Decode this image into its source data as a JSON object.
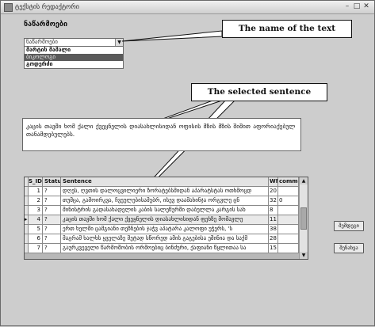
{
  "window": {
    "title": "ტექსტის რედაქტორი",
    "controls": [
      "–",
      "□",
      "✕"
    ]
  },
  "text_section": {
    "heading": "ნაწარმოები",
    "combo_value": "ნაწარმოები",
    "options": [
      "მარტის მამალი",
      "ბიკოლოგი",
      "გოდერძი"
    ],
    "selected_index": 1
  },
  "callouts": {
    "text_name": "The name of the text",
    "selected_sentence": "The selected sentence"
  },
  "sentence_box": {
    "text": "კაცის თავში ხომ ქალი ქვეყნელის დიასახლისიდან  ოფისის მზის მზის შიშით აფორიაქებულ თანამდებულებს."
  },
  "grid": {
    "headers": {
      "indicator": "",
      "id": "S_ID",
      "status": "Status",
      "sentence": "Sentence",
      "wn": "WNo",
      "comments": "comments"
    },
    "rows": [
      {
        "id": "1",
        "status": "?",
        "sentence": "დღეს, ღვთის დალოცვილიერი ზორატებსმიდან აპარატსტას ოთხმოცდ",
        "wn": "20",
        "comments": ""
      },
      {
        "id": "2",
        "status": "?",
        "sentence": "თუმცა, გამოირკვა, ჩვეულებისამებრ, ისევ დაამახინჯა ორგვლე ცნ",
        "wn": "32",
        "comments": "0"
      },
      {
        "id": "3",
        "status": "?",
        "sentence": "მინისტრის გადასახადელის კაბის სალეწურში დაბულლა კარგის სახ",
        "wn": "8",
        "comments": ""
      },
      {
        "id": "4",
        "status": "?",
        "sentence": "კაცის თავში ხომ ქალი ქვეყნელის დიასახლისიდან ფეხზე მომავლე",
        "wn": "11",
        "comments": ""
      },
      {
        "id": "5",
        "status": "?",
        "sentence": "ერთ ხელში ცამგიანი თეზნების ჯაჭვ აპატარა კალოფი უჭერს, 'ს",
        "wn": "38",
        "comments": ""
      },
      {
        "id": "6",
        "status": "?",
        "sentence": "მაგრამ ხალხს ყველაზე მეტად სწორედ ამის გაგებისა ეშინია და საქმ",
        "wn": "28",
        "comments": ""
      },
      {
        "id": "7",
        "status": "?",
        "sentence": "გაურკვეველი წარმოშობის ორმოებიც ბინძური, ქაფიანი წყლითაა სა",
        "wn": "15",
        "comments": ""
      }
    ],
    "selected_row": 3
  },
  "buttons": {
    "next": "შემდეგი",
    "save": "შენახვა"
  }
}
